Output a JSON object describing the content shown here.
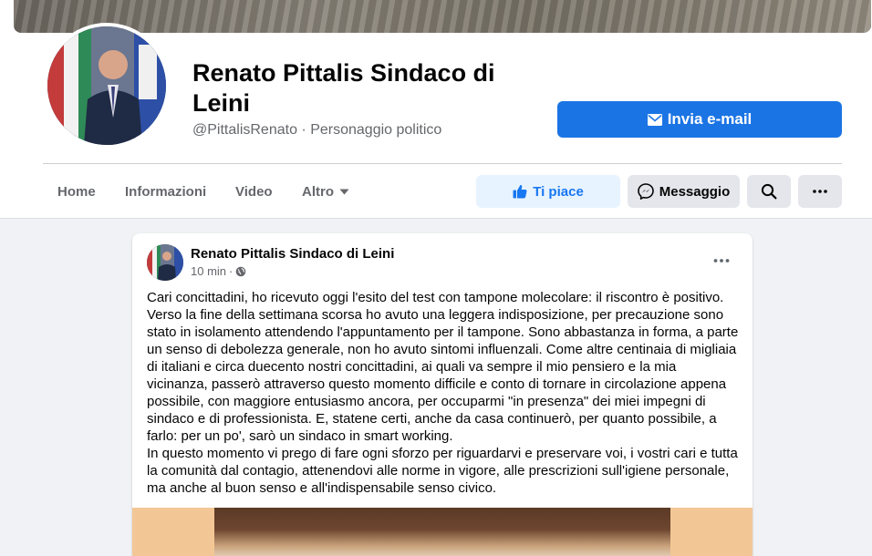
{
  "header": {
    "page_name": "Renato Pittalis Sindaco di Leini",
    "handle": "@PittalisRenato",
    "separator": "·",
    "category": "Personaggio politico",
    "email_button": "Invia e-mail"
  },
  "tabs": [
    {
      "label": "Home"
    },
    {
      "label": "Informazioni"
    },
    {
      "label": "Video"
    },
    {
      "label": "Altro"
    }
  ],
  "actions": {
    "like": "Ti piace",
    "message": "Messaggio"
  },
  "post": {
    "author": "Renato Pittalis Sindaco di Leini",
    "time": "10 min",
    "dot": "·",
    "paragraph1": "Cari concittadini, ho ricevuto oggi l'esito del test con tampone molecolare: il riscontro è positivo. Verso la fine della settimana scorsa ho avuto una leggera indisposizione, per precauzione sono stato in isolamento attendendo l'appuntamento per il tampone. Sono abbastanza in forma, a parte un senso di debolezza generale, non ho avuto sintomi influenzali. Come altre centinaia di migliaia di italiani e circa duecento nostri concittadini, ai quali va sempre il mio pensiero e la mia vicinanza, passerò attraverso questo momento difficile e conto di tornare in circolazione appena possibile, con maggiore entusiasmo ancora, per occuparmi \"in presenza\" dei miei impegni di sindaco e di professionista. E, statene certi, anche da casa continuerò, per quanto possibile, a farlo: per un po', sarò un sindaco in smart working.",
    "paragraph2": "In questo momento vi prego di fare ogni sforzo per riguardarvi e preservare voi, i vostri cari e tutta la comunità dal contagio, attenendovi alle norme in vigore, alle prescrizioni sull'igiene personale, ma anche al buon senso e all'indispensabile senso civico."
  },
  "colors": {
    "primary": "#1b74e4",
    "like_bg": "#e7f3ff",
    "secondary_bg": "#e4e6eb",
    "page_bg": "#f0f2f5"
  },
  "icons": {
    "email": "envelope-icon",
    "dropdown": "caret-down-icon",
    "like": "thumbs-up-icon",
    "message": "messenger-icon",
    "search": "search-icon",
    "more": "more-dots-icon",
    "privacy": "globe-icon"
  }
}
